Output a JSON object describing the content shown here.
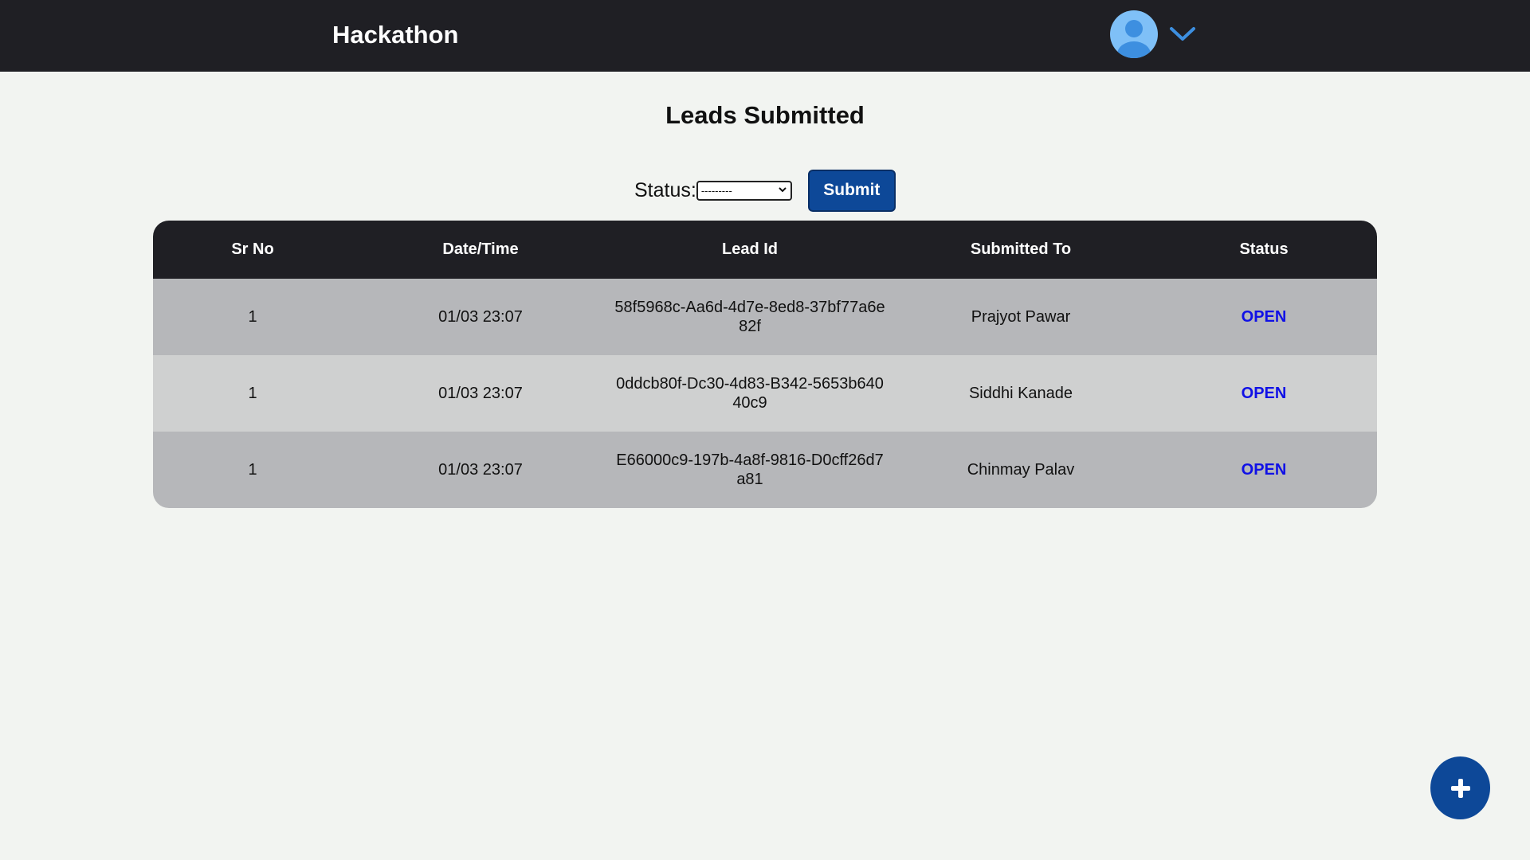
{
  "navbar": {
    "brand": "Hackathon",
    "avatar_icon": "user-avatar-icon",
    "menu_icon": "chevron-down-icon",
    "accent": "#3d8fe0"
  },
  "page": {
    "title": "Leads Submitted"
  },
  "filter": {
    "label": "Status:",
    "select_value": "---------",
    "submit_label": "Submit"
  },
  "table": {
    "columns": [
      "Sr No",
      "Date/Time",
      "Lead Id",
      "Submitted To",
      "Status"
    ],
    "rows": [
      {
        "sr_no": "1",
        "datetime": "01/03 23:07",
        "lead_id": "58f5968c-Aa6d-4d7e-8ed8-37bf77a6e82f",
        "submitted_to": "Prajyot Pawar",
        "status": "OPEN"
      },
      {
        "sr_no": "1",
        "datetime": "01/03 23:07",
        "lead_id": "0ddcb80f-Dc30-4d83-B342-5653b64040c9",
        "submitted_to": "Siddhi Kanade",
        "status": "OPEN"
      },
      {
        "sr_no": "1",
        "datetime": "01/03 23:07",
        "lead_id": "E66000c9-197b-4a8f-9816-D0cff26d7a81",
        "submitted_to": "Chinmay Palav",
        "status": "OPEN"
      }
    ]
  },
  "fab": {
    "icon": "plus-icon",
    "color": "#0d4898"
  },
  "colors": {
    "navbar_bg": "#1f1f24",
    "page_bg": "#f2f4f1",
    "primary": "#0d4898",
    "status_open": "#1010e6"
  }
}
